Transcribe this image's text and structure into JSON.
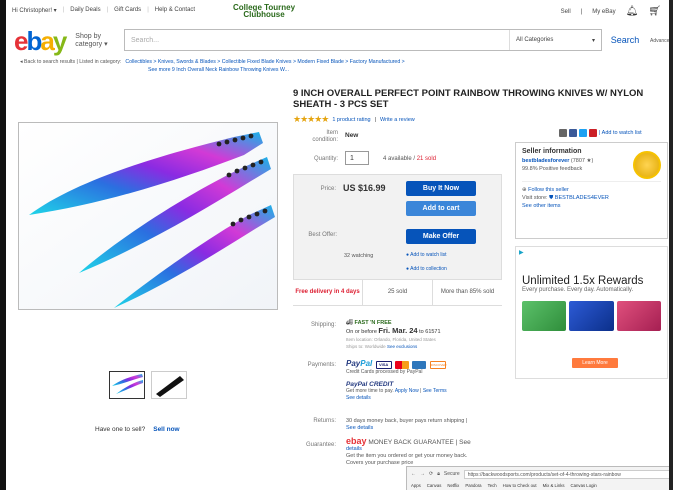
{
  "topbar": {
    "greeting": "Hi Christopher! ▾",
    "links": [
      "Daily Deals",
      "Gift Cards",
      "Help & Contact"
    ],
    "promo_line1": "College Tourney",
    "promo_line2": "Clubhouse",
    "right_links": [
      "Sell",
      "My eBay"
    ]
  },
  "header": {
    "logo_letters": [
      "e",
      "b",
      "a",
      "y"
    ],
    "shop_by": "Shop by\ncategory ▾",
    "search_placeholder": "Search...",
    "category": "All Categories",
    "search_button": "Search",
    "advanced": "Advanced"
  },
  "breadcrumb": {
    "back": "◂  Back to search results | Listed in category:",
    "path_line1": "Collectibles > Knives, Swords & Blades > Collectible Fixed Blade Knives > Modern Fixed Blade > Factory Manufactured >",
    "path_line2": "See more 9 Inch Overall Neck Rainbow Throwing Knives W..."
  },
  "item": {
    "title": "9 INCH OVERALL PERFECT POINT RAINBOW THROWING KNIVES W/ NYLON SHEATH - 3 PCS SET",
    "stars": "★★★★★",
    "rating_link": "1 product rating",
    "review_link": "Write a review",
    "condition_label": "Item condition:",
    "condition": "New",
    "quantity_label": "Quantity:",
    "quantity": "1",
    "available": "4 available /",
    "sold_count": "21 sold",
    "price_label": "Price:",
    "price": "US $16.99",
    "buy_now": "Buy It Now",
    "add_to_cart": "Add to cart",
    "best_offer_label": "Best Offer:",
    "make_offer": "Make Offer",
    "watching": "32 watching",
    "add_watch": "●  Add to watch list",
    "add_collection": "●  Add to collection",
    "strip": [
      "Free delivery in 4 days",
      "25 sold",
      "More than 85% sold"
    ]
  },
  "shipping": {
    "label": "Shipping:",
    "free": "FAST 'N FREE",
    "on_before": "On or before",
    "date": "Fri. Mar. 24",
    "to": "to 61571",
    "from": "Item location: Orlando, Florida, United States",
    "ships_to": "Ships to: Worldwide",
    "exclusions": "See exclusions"
  },
  "payments": {
    "label": "Payments:",
    "paypal_a": "Pay",
    "paypal_b": "Pal",
    "cards": [
      "VISA",
      "",
      "",
      "DISCOVER"
    ],
    "processed": "Credit Cards processed by PayPal",
    "credit": "PayPal CREDIT",
    "credit_line": "Get more time to pay.",
    "apply": "Apply Now",
    "terms": "See Terms",
    "details": "See details"
  },
  "returns": {
    "label": "Returns:",
    "text": "30 days money back, buyer pays return shipping |",
    "link": "See details"
  },
  "guarantee": {
    "label": "Guarantee:",
    "ebay": "ebay",
    "text": "MONEY BACK GUARANTEE",
    "see": "| See",
    "details": "details",
    "line2": "Get the item you ordered or get your money back.",
    "line3": "Covers your purchase price"
  },
  "seller": {
    "heading": "Seller information",
    "name": "bestbladesforever",
    "score": "(7807 ★)",
    "feedback": "99.8% Positive feedback",
    "follow": "Follow this seller",
    "store_label": "Visit store:",
    "store": "BESTBLADES4EVER",
    "other": "See other items"
  },
  "share": {
    "watch": "| Add to watch list"
  },
  "ad": {
    "headline": "Unlimited 1.5x Rewards",
    "sub": "Every purchase. Every day. Automatically.",
    "cta": "Learn More"
  },
  "thumbs_sell": {
    "question": "Have one to sell?",
    "sell_now": "Sell now"
  },
  "chrome": {
    "secure": "Secure",
    "url": "https://backwoodsports.com/products/set-of-4-throwing-stars-rainbow",
    "bookmarks": [
      "Apps",
      "Canvas",
      "Netflix",
      "Pandora",
      "Tech",
      "How to Check out",
      "Mix & Links",
      "Canvas Login"
    ]
  },
  "colors": {
    "ebay_blue": "#0654ba",
    "sold_red": "#dd1e31",
    "free_green": "#2b6a1c"
  }
}
